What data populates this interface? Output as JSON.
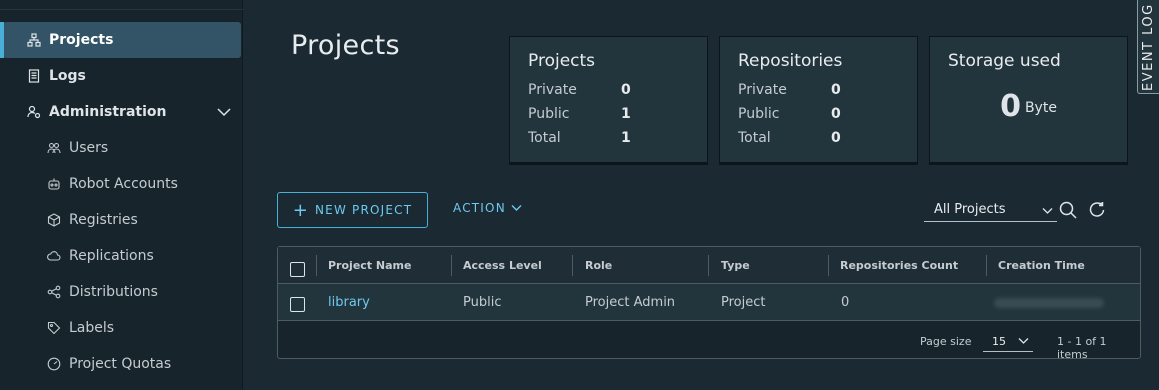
{
  "sidebar": {
    "items": [
      {
        "label": "Projects",
        "icon": "projects-icon",
        "active": true
      },
      {
        "label": "Logs",
        "icon": "logs-icon"
      },
      {
        "label": "Administration",
        "icon": "administration-icon",
        "expanded": true
      },
      {
        "label": "Users",
        "icon": "users-icon"
      },
      {
        "label": "Robot Accounts",
        "icon": "robot-icon"
      },
      {
        "label": "Registries",
        "icon": "registries-icon"
      },
      {
        "label": "Replications",
        "icon": "replications-icon"
      },
      {
        "label": "Distributions",
        "icon": "distributions-icon"
      },
      {
        "label": "Labels",
        "icon": "labels-icon"
      },
      {
        "label": "Project Quotas",
        "icon": "quotas-icon"
      }
    ]
  },
  "page": {
    "title": "Projects"
  },
  "summary": {
    "projects": {
      "title": "Projects",
      "rows": [
        {
          "label": "Private",
          "value": "0"
        },
        {
          "label": "Public",
          "value": "1"
        },
        {
          "label": "Total",
          "value": "1"
        }
      ]
    },
    "repositories": {
      "title": "Repositories",
      "rows": [
        {
          "label": "Private",
          "value": "0"
        },
        {
          "label": "Public",
          "value": "0"
        },
        {
          "label": "Total",
          "value": "0"
        }
      ]
    },
    "storage": {
      "title": "Storage used",
      "value": "0",
      "unit": "Byte"
    }
  },
  "event_log": {
    "label": "EVENT LOG"
  },
  "toolbar": {
    "new_project_plus": "+",
    "new_project_label": "NEW PROJECT",
    "action_label": "ACTION",
    "filter_value": "All Projects"
  },
  "table": {
    "columns": [
      "Project Name",
      "Access Level",
      "Role",
      "Type",
      "Repositories Count",
      "Creation Time"
    ],
    "rows": [
      {
        "name": "library",
        "access": "Public",
        "role": "Project Admin",
        "type": "Project",
        "repo_count": "0"
      }
    ],
    "footer": {
      "page_size_label": "Page size",
      "page_size": "15",
      "page_info": "1 - 1 of 1 items"
    }
  },
  "colors": {
    "accent": "#49afd9",
    "link": "#6ec9ef",
    "background": "#1b2a32",
    "sidebar": "#17242b",
    "active_item": "#325466"
  }
}
